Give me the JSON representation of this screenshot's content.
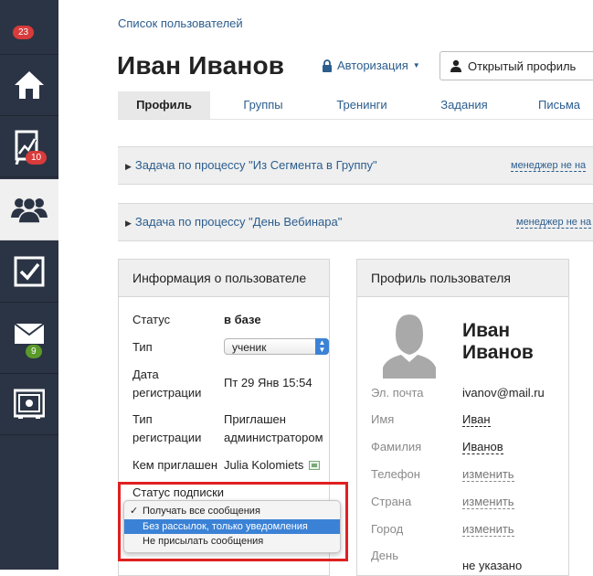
{
  "sidebar": {
    "items": [
      {
        "icon": "notifications-icon",
        "badge": "23"
      },
      {
        "icon": "home-icon"
      },
      {
        "icon": "analytics-icon",
        "badge": "10"
      },
      {
        "icon": "users-icon",
        "active": true
      },
      {
        "icon": "tasks-checkbox-icon"
      },
      {
        "icon": "mail-icon",
        "badge": "9"
      },
      {
        "icon": "safe-icon"
      }
    ]
  },
  "header": {
    "breadcrumb": "Список пользователей",
    "title": "Иван Иванов",
    "auth_label": "Авторизация",
    "open_profile_label": "Открытый профиль"
  },
  "tabs": [
    "Профиль",
    "Группы",
    "Тренинги",
    "Задания",
    "Письма"
  ],
  "tasks": [
    {
      "label": "Задача по процессу \"Из Сегмента в Группу\"",
      "manager": "менеджер не на"
    },
    {
      "label": "Задача по процессу \"День Вебинара\"",
      "manager": "менеджер не на"
    }
  ],
  "user_info": {
    "title": "Информация о пользователе",
    "status_label": "Статус",
    "status_value": "в базе",
    "type_label": "Тип",
    "type_value": "ученик",
    "reg_date_label_1": "Дата",
    "reg_date_label_2": "регистрации",
    "reg_date_value": "Пт 29 Янв 15:54",
    "reg_type_label_1": "Тип",
    "reg_type_label_2": "регистрации",
    "reg_type_value_1": "Приглашен",
    "reg_type_value_2": "администратором",
    "invited_by_label": "Кем приглашен",
    "invited_by_value": "Julia Kolomiets",
    "subscription_label": "Статус подписки",
    "subscription_options": [
      "Получать все сообщения",
      "Без рассылок, только уведомления",
      "Не присылать сообщения"
    ],
    "subscription_checked_index": 0,
    "subscription_highlight_index": 1
  },
  "profile": {
    "title": "Профиль пользователя",
    "first_name_display": "Иван",
    "last_name_display": "Иванов",
    "email_label": "Эл. почта",
    "email_value": "ivanov@mail.ru",
    "name_label": "Имя",
    "name_value": "Иван",
    "surname_label": "Фамилия",
    "surname_value": "Иванов",
    "phone_label": "Телефон",
    "country_label": "Страна",
    "city_label": "Город",
    "change_link": "изменить",
    "birthday_label": "День",
    "birthday_value": "не указано"
  },
  "colors": {
    "sidebar": "#2b3444",
    "link": "#2b5d8e",
    "badge_red": "#d83b3b",
    "badge_green": "#5a9a2a",
    "select_blue": "#3b82d6",
    "highlight": "#e02020"
  }
}
